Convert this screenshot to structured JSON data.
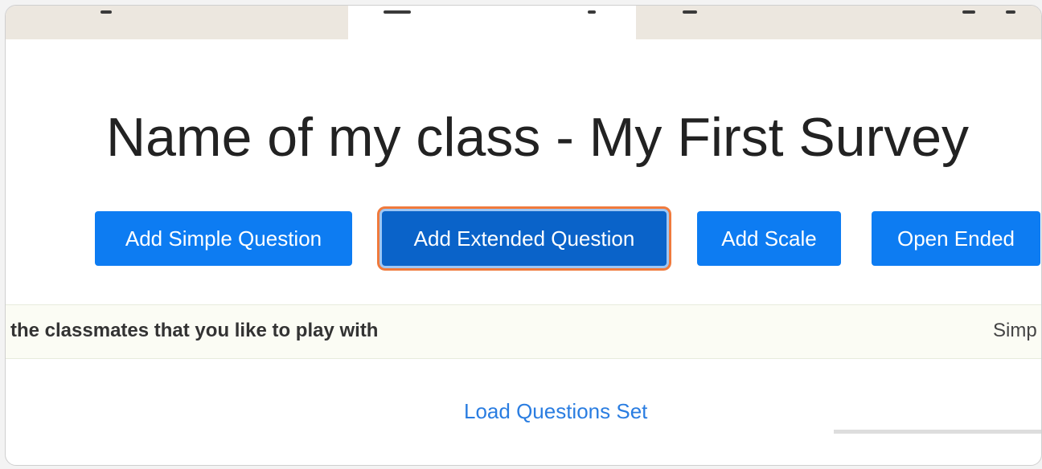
{
  "page": {
    "title": "Name of my class - My First Survey"
  },
  "toolbar": {
    "add_simple_label": "Add Simple Question",
    "add_extended_label": "Add Extended Question",
    "add_scale_label": "Add Scale",
    "open_ended_label": "Open Ended"
  },
  "questions": [
    {
      "text": "the classmates that you like to play with",
      "type": "Simp"
    }
  ],
  "footer": {
    "load_set_label": "Load Questions Set"
  },
  "colors": {
    "button": "#0d7cf2",
    "button_focused": "#0a63c9",
    "focus_ring": "#f07a3c",
    "link": "#2a7de1",
    "row_bg": "#fbfcf4"
  }
}
